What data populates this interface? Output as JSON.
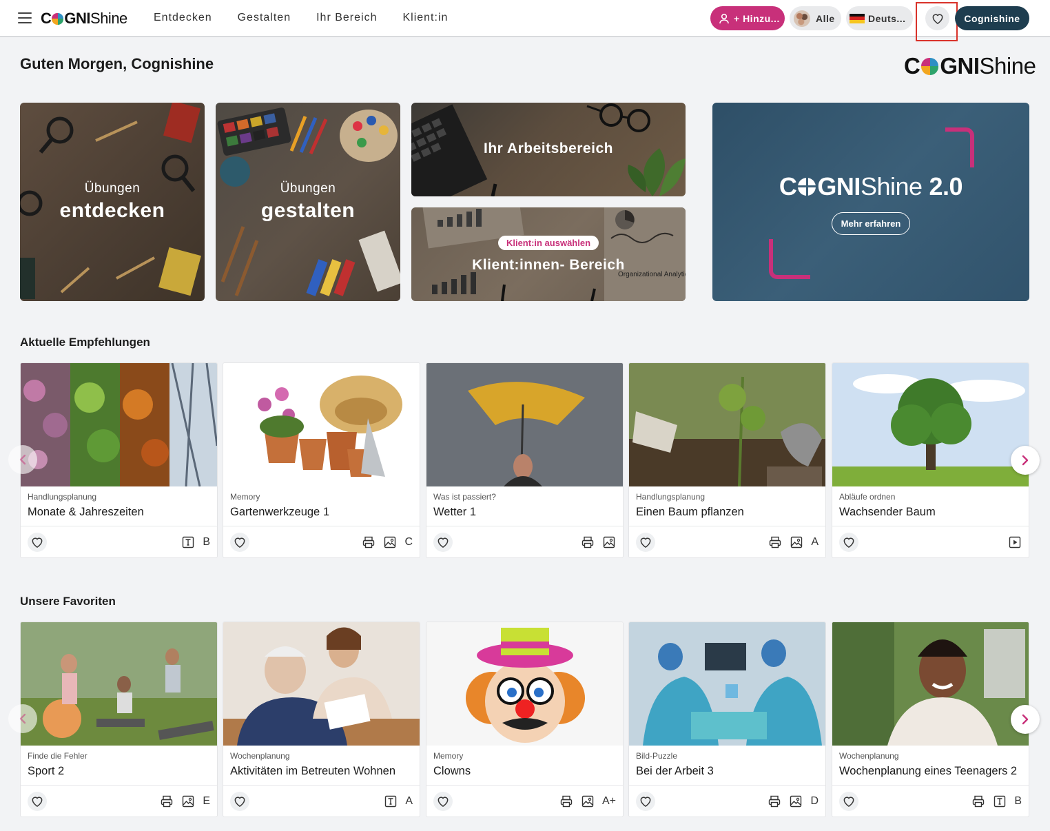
{
  "header": {
    "logo": {
      "pre": "C",
      "mid": "GNI",
      "post": "Shine"
    },
    "nav": [
      "Entdecken",
      "Gestalten",
      "Ihr Bereich",
      "Klient:in"
    ],
    "add_client_label": "+ Hinzu...",
    "all_label": "Alle",
    "language_label": "Deuts...",
    "user_label": "Cognishine"
  },
  "greeting": "Guten Morgen, Cognishine",
  "brand_logo": {
    "pre": "C",
    "mid": "GNI",
    "post": "Shine"
  },
  "colors": {
    "accent": "#c8307a",
    "navy": "#1e3d4f",
    "hero_blue": "#3b5f78"
  },
  "hero": {
    "discover": {
      "small": "Übungen",
      "large": "entdecken"
    },
    "create": {
      "small": "Übungen",
      "large": "gestalten"
    },
    "workspace": {
      "label": "Ihr Arbeitsbereich"
    },
    "clients": {
      "badge": "Klient:in auswählen",
      "label": "Klient:innen- Bereich",
      "img_text": "Organizational Analytics"
    },
    "promo": {
      "logo_pre": "C",
      "logo_mid": "GNI",
      "logo_post": "Shine",
      "version": "2.0",
      "button": "Mehr erfahren"
    }
  },
  "sections": {
    "recommendations": {
      "title": "Aktuelle Empfehlungen",
      "cards": [
        {
          "category": "Handlungsplanung",
          "title": "Monate & Jahreszeiten",
          "icons": [
            "text-icon"
          ],
          "level": "B"
        },
        {
          "category": "Memory",
          "title": "Gartenwerkzeuge 1",
          "icons": [
            "print-icon",
            "image-icon"
          ],
          "level": "C"
        },
        {
          "category": "Was ist passiert?",
          "title": "Wetter 1",
          "icons": [
            "print-icon",
            "image-icon"
          ],
          "level": ""
        },
        {
          "category": "Handlungsplanung",
          "title": "Einen Baum pflanzen",
          "icons": [
            "print-icon",
            "image-icon"
          ],
          "level": "A"
        },
        {
          "category": "Abläufe ordnen",
          "title": "Wachsender Baum",
          "icons": [
            "video-icon"
          ],
          "level": ""
        }
      ]
    },
    "favorites": {
      "title": "Unsere Favoriten",
      "cards": [
        {
          "category": "Finde die Fehler",
          "title": "Sport 2",
          "icons": [
            "print-icon",
            "image-icon"
          ],
          "level": "E"
        },
        {
          "category": "Wochenplanung",
          "title": "Aktivitäten im Betreuten Wohnen",
          "icons": [
            "text-icon"
          ],
          "level": "A"
        },
        {
          "category": "Memory",
          "title": "Clowns",
          "icons": [
            "print-icon",
            "image-icon"
          ],
          "level": "A+"
        },
        {
          "category": "Bild-Puzzle",
          "title": "Bei der Arbeit 3",
          "icons": [
            "print-icon",
            "image-icon"
          ],
          "level": "D"
        },
        {
          "category": "Wochenplanung",
          "title": "Wochenplanung eines Teenagers 2",
          "icons": [
            "print-icon",
            "text-icon"
          ],
          "level": "B"
        }
      ]
    }
  }
}
